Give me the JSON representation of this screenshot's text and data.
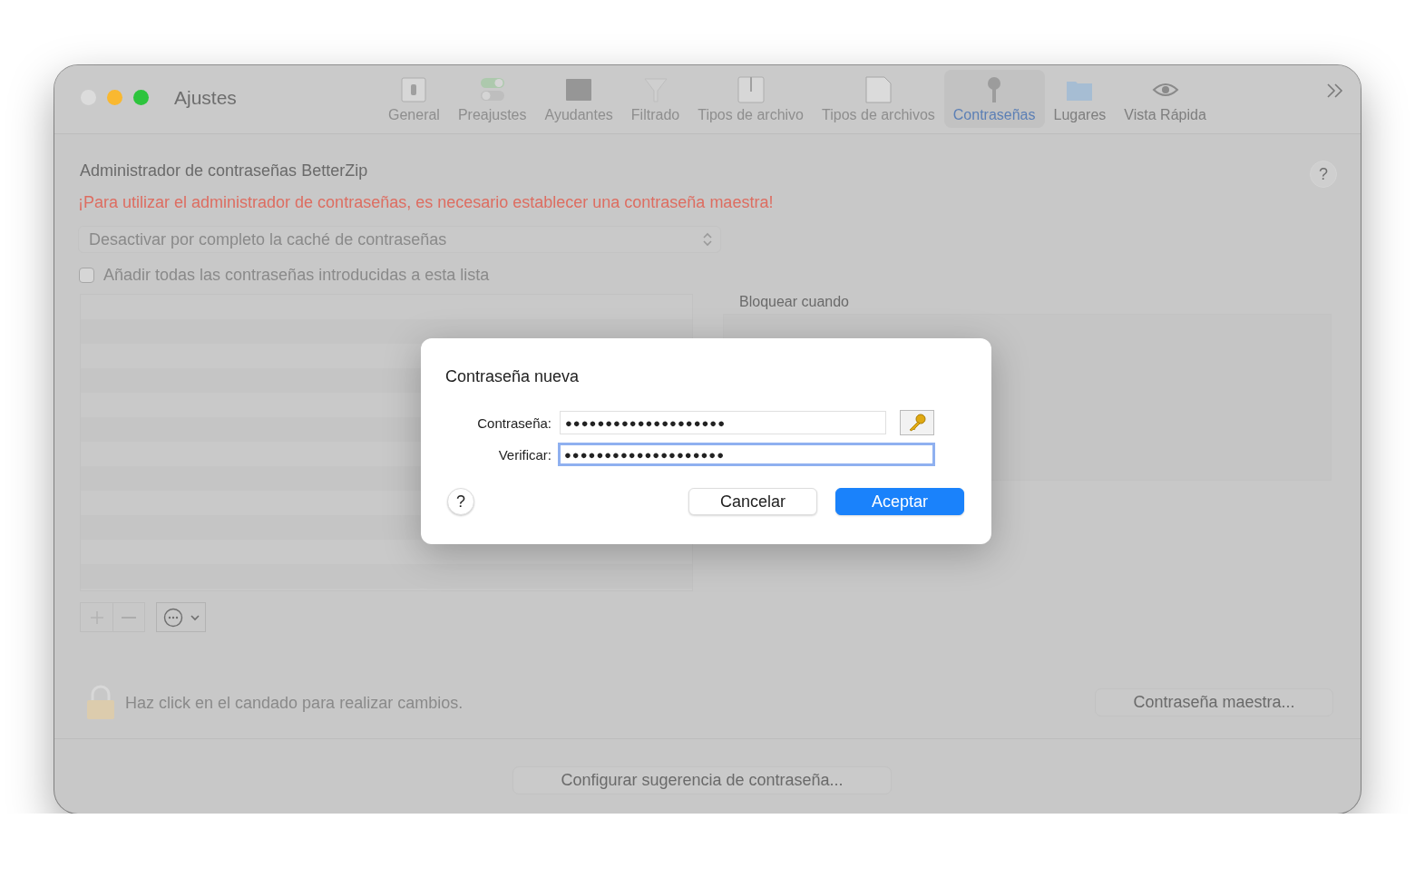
{
  "window": {
    "title": "Ajustes"
  },
  "toolbar": {
    "tabs": [
      {
        "label": "General",
        "selected": false,
        "disabled": true
      },
      {
        "label": "Preajustes",
        "selected": false,
        "disabled": true
      },
      {
        "label": "Ayudantes",
        "selected": false,
        "disabled": true
      },
      {
        "label": "Filtrado",
        "selected": false,
        "disabled": true
      },
      {
        "label": "Tipos de archivo",
        "selected": false,
        "disabled": true
      },
      {
        "label": "Tipos de archivos",
        "selected": false,
        "disabled": true
      },
      {
        "label": "Contraseñas",
        "selected": true,
        "disabled": false
      },
      {
        "label": "Lugares",
        "selected": false,
        "disabled": false
      },
      {
        "label": "Vista Rápida",
        "selected": false,
        "disabled": false
      }
    ]
  },
  "content": {
    "title": "Administrador de contraseñas BetterZip",
    "help": "?",
    "warning": "¡Para utilizar el administrador de contraseñas, es necesario establecer una contraseña maestra!",
    "cache_dropdown": {
      "value": "Desactivar por completo la caché de contraseñas",
      "disabled": true
    },
    "add_checkbox": {
      "label": "Añadir todas las contraseñas introducidas a esta lista",
      "checked": false,
      "disabled": true
    },
    "lock_group": {
      "label": "Bloquear cuando"
    },
    "lock_hint": "Haz click en el candado para realizar cambios.",
    "master_button": "Contraseña maestra...",
    "hint_button": "Configurar sugerencia de contraseña..."
  },
  "dialog": {
    "title": "Contraseña nueva",
    "help": "?",
    "fields": [
      {
        "label": "Contraseña:",
        "value": "●●●●●●●●●●●●●●●●●●●●",
        "focused": false
      },
      {
        "label": "Verificar:",
        "value": "●●●●●●●●●●●●●●●●●●●●",
        "focused": true
      }
    ],
    "buttons": [
      {
        "label": "Cancelar",
        "default": false
      },
      {
        "label": "Aceptar",
        "default": true
      }
    ]
  }
}
